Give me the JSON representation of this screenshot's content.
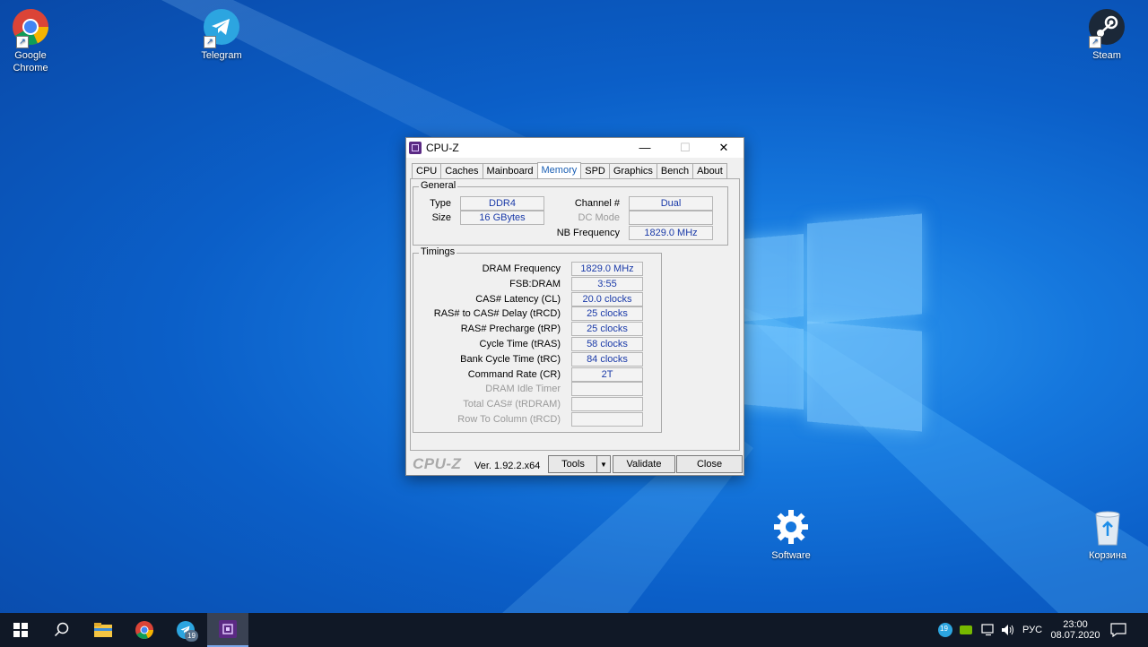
{
  "desktop": {
    "icons": [
      {
        "label": "Google Chrome",
        "icon": "chrome-icon"
      },
      {
        "label": "Telegram",
        "icon": "telegram-icon"
      },
      {
        "label": "Steam",
        "icon": "steam-icon"
      },
      {
        "label": "Software",
        "icon": "gear-icon"
      },
      {
        "label": "Корзина",
        "icon": "recycle-bin-icon"
      }
    ]
  },
  "window": {
    "title": "CPU-Z",
    "tabs": [
      "CPU",
      "Caches",
      "Mainboard",
      "Memory",
      "SPD",
      "Graphics",
      "Bench",
      "About"
    ],
    "active_tab": "Memory",
    "general": {
      "title": "General",
      "type_label": "Type",
      "type_value": "DDR4",
      "size_label": "Size",
      "size_value": "16 GBytes",
      "channel_label": "Channel #",
      "channel_value": "Dual",
      "dcmode_label": "DC Mode",
      "dcmode_value": "",
      "nbfreq_label": "NB Frequency",
      "nbfreq_value": "1829.0 MHz"
    },
    "timings": {
      "title": "Timings",
      "rows": [
        {
          "label": "DRAM Frequency",
          "value": "1829.0 MHz",
          "enabled": true
        },
        {
          "label": "FSB:DRAM",
          "value": "3:55",
          "enabled": true
        },
        {
          "label": "CAS# Latency (CL)",
          "value": "20.0 clocks",
          "enabled": true
        },
        {
          "label": "RAS# to CAS# Delay (tRCD)",
          "value": "25 clocks",
          "enabled": true
        },
        {
          "label": "RAS# Precharge (tRP)",
          "value": "25 clocks",
          "enabled": true
        },
        {
          "label": "Cycle Time (tRAS)",
          "value": "58 clocks",
          "enabled": true
        },
        {
          "label": "Bank Cycle Time (tRC)",
          "value": "84 clocks",
          "enabled": true
        },
        {
          "label": "Command Rate (CR)",
          "value": "2T",
          "enabled": true
        },
        {
          "label": "DRAM Idle Timer",
          "value": "",
          "enabled": false
        },
        {
          "label": "Total CAS# (tRDRAM)",
          "value": "",
          "enabled": false
        },
        {
          "label": "Row To Column (tRCD)",
          "value": "",
          "enabled": false
        }
      ]
    },
    "footer": {
      "brand": "CPU-Z",
      "version": "Ver. 1.92.2.x64",
      "tools_label": "Tools",
      "validate_label": "Validate",
      "close_label": "Close"
    }
  },
  "taskbar": {
    "telegram_badge": "19",
    "tray_badge": "19",
    "language": "РУС",
    "time": "23:00",
    "date": "08.07.2020"
  },
  "colors": {
    "accent": "#1a5fb4",
    "value_text": "#1a3aa8",
    "taskbar": "#101826"
  }
}
